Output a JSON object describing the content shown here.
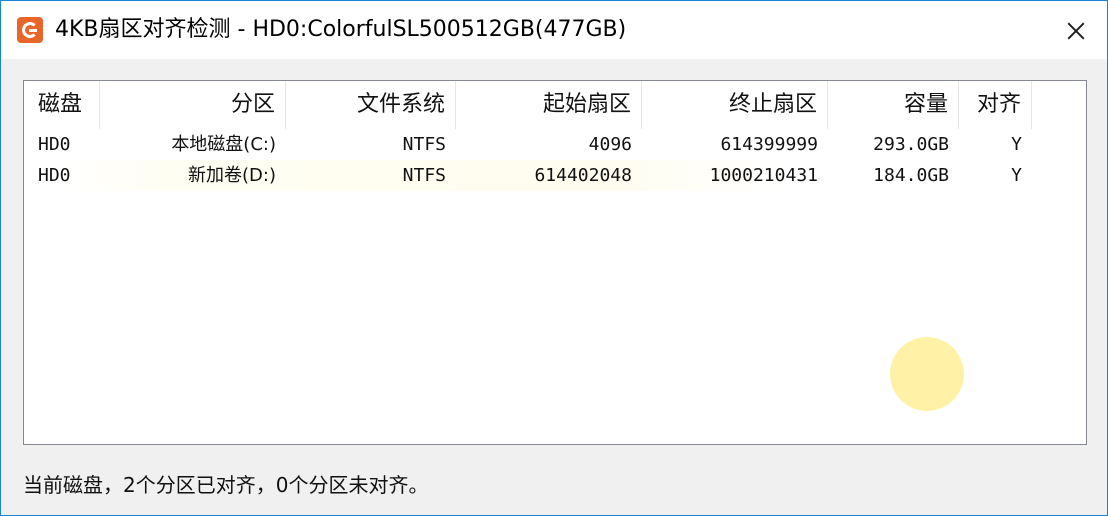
{
  "window": {
    "title": "4KB扇区对齐检测 - HD0:ColorfulSL500512GB(477GB)",
    "icon": "diskgenius-app-icon",
    "close_icon": "close-icon",
    "accent_color": "#e8662a"
  },
  "table": {
    "columns": [
      {
        "label": "磁盘"
      },
      {
        "label": "分区"
      },
      {
        "label": "文件系统"
      },
      {
        "label": "起始扇区"
      },
      {
        "label": "终止扇区"
      },
      {
        "label": "容量"
      },
      {
        "label": "对齐"
      }
    ],
    "rows": [
      {
        "disk": "HD0",
        "partition": "本地磁盘(C:)",
        "filesystem": "NTFS",
        "start_sector": "4096",
        "end_sector": "614399999",
        "capacity": "293.0GB",
        "aligned": "Y"
      },
      {
        "disk": "HD0",
        "partition": "新加卷(D:)",
        "filesystem": "NTFS",
        "start_sector": "614402048",
        "end_sector": "1000210431",
        "capacity": "184.0GB",
        "aligned": "Y"
      }
    ]
  },
  "status": {
    "text": "当前磁盘，2个分区已对齐，0个分区未对齐。"
  }
}
